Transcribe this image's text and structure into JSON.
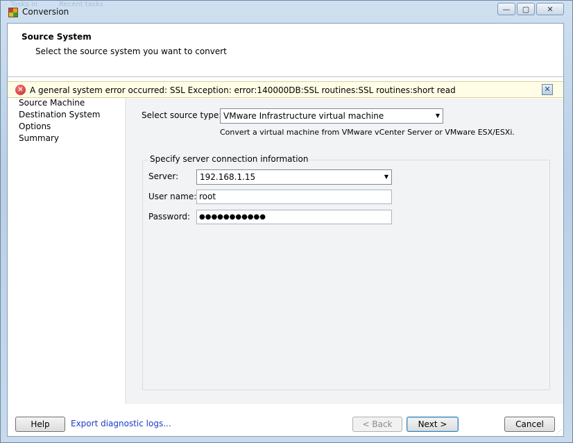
{
  "window": {
    "title": "Conversion",
    "icon": "converter-app-icon",
    "controls": {
      "minimize": "—",
      "maximize": "▢",
      "close": "✕"
    },
    "background_ghost_text": [
      "Tasks in",
      "Recent tasks"
    ]
  },
  "header": {
    "title": "Source System",
    "subtitle": "Select the source system you want to convert"
  },
  "error_bar": {
    "icon": "error-icon",
    "message": "A general system error occurred: SSL Exception: error:140000DB:SSL routines:SSL routines:short read",
    "close_glyph": "✕"
  },
  "nav": {
    "items": [
      {
        "label": "Source Machine"
      },
      {
        "label": "Destination System"
      },
      {
        "label": "Options"
      },
      {
        "label": "Summary"
      }
    ]
  },
  "source": {
    "type_label": "Select source type:",
    "type_value": "VMware Infrastructure virtual machine",
    "type_hint": "Convert a virtual machine from VMware vCenter Server or VMware ESX/ESXi."
  },
  "connection": {
    "group_title": "Specify server connection information",
    "server_label": "Server:",
    "server_value": "192.168.1.15",
    "username_label": "User name:",
    "username_value": "root",
    "password_label": "Password:",
    "password_value": "●●●●●●●●●●●"
  },
  "footer": {
    "help": "Help",
    "export_logs": "Export diagnostic logs...",
    "back": "< Back",
    "next": "Next >",
    "cancel": "Cancel"
  },
  "colors": {
    "error_bg": "#fffde6",
    "link": "#1a3cc8",
    "content_bg": "#f2f3f5",
    "frame": "#b9cfe6"
  }
}
